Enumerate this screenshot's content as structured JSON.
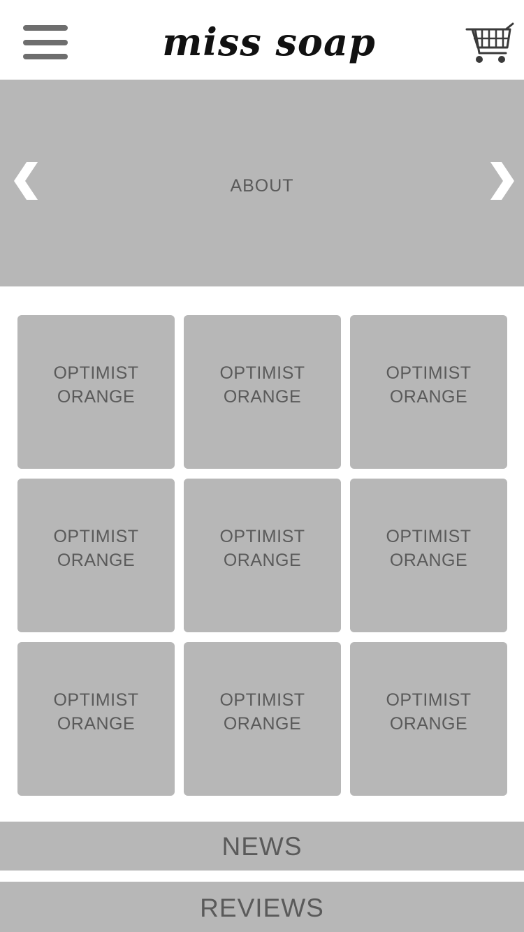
{
  "header": {
    "brand": "miss soap"
  },
  "hero": {
    "title": "ABOUT"
  },
  "products": [
    {
      "line1": "OPTIMIST",
      "line2": "ORANGE"
    },
    {
      "line1": "OPTIMIST",
      "line2": "ORANGE"
    },
    {
      "line1": "OPTIMIST",
      "line2": "ORANGE"
    },
    {
      "line1": "OPTIMIST",
      "line2": "ORANGE"
    },
    {
      "line1": "OPTIMIST",
      "line2": "ORANGE"
    },
    {
      "line1": "OPTIMIST",
      "line2": "ORANGE"
    },
    {
      "line1": "OPTIMIST",
      "line2": "ORANGE"
    },
    {
      "line1": "OPTIMIST",
      "line2": "ORANGE"
    },
    {
      "line1": "OPTIMIST",
      "line2": "ORANGE"
    }
  ],
  "sections": {
    "news": "NEWS",
    "reviews": "REVIEWS"
  },
  "icons": {
    "menu": "hamburger-menu-icon",
    "cart": "shopping-cart-icon",
    "prev": "chevron-left-icon",
    "next": "chevron-right-icon"
  },
  "colors": {
    "panel": "#b7b7b7",
    "text": "#5a5a5a",
    "icon": "#6e6e6e",
    "brand": "#111111"
  }
}
